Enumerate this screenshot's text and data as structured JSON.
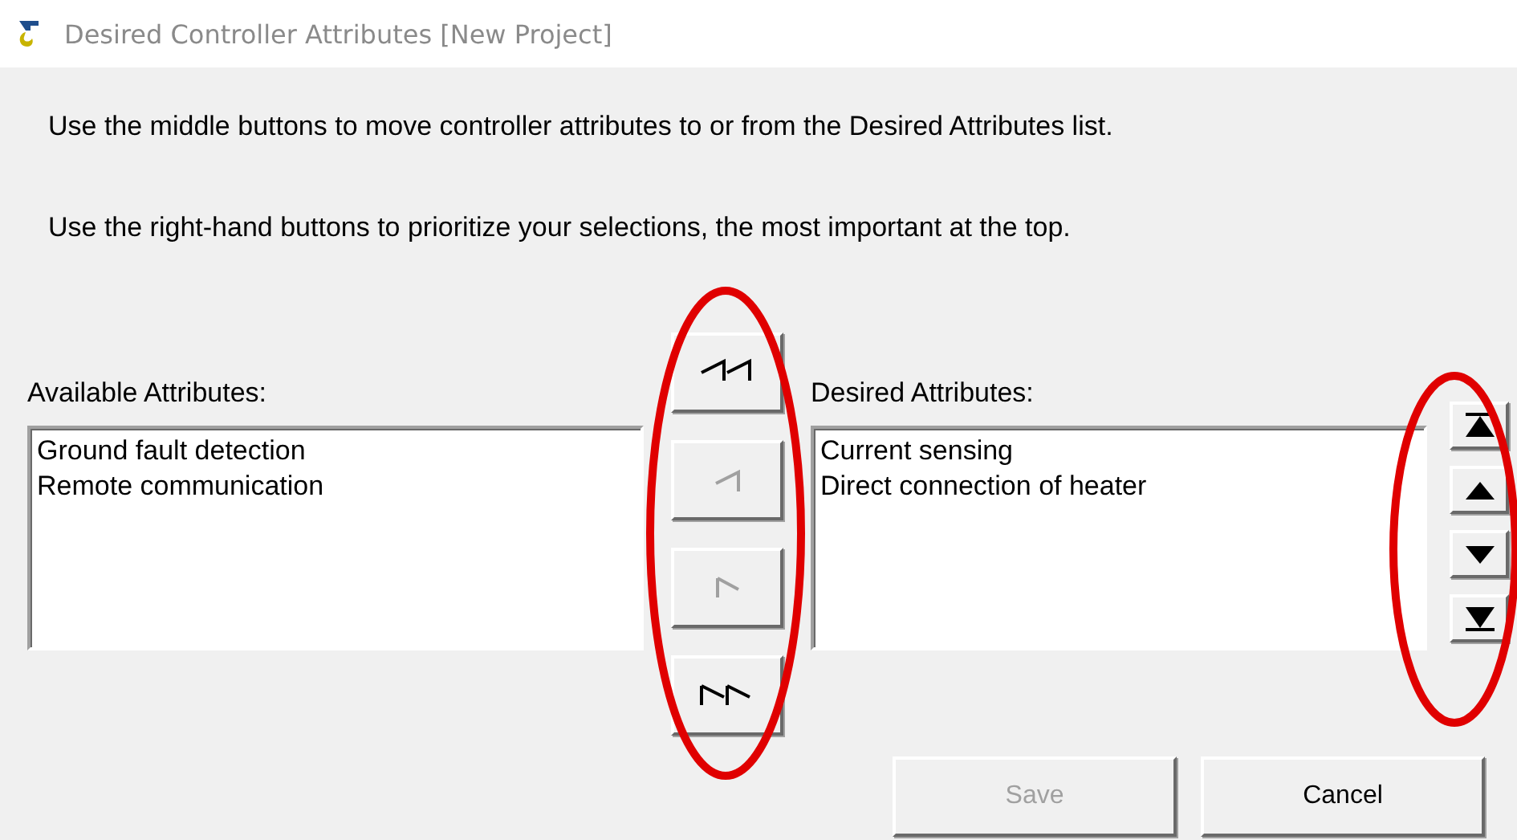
{
  "window": {
    "title": "Desired Controller Attributes [New Project]"
  },
  "instructions": [
    "Use the middle buttons to move controller attributes to or from the Desired Attributes list.",
    "Use the right-hand buttons to prioritize your selections, the most important at the top."
  ],
  "available": {
    "label": "Available Attributes:",
    "items": [
      "Ground fault detection",
      "Remote communication"
    ]
  },
  "move_buttons": [
    {
      "kind": "remove_all",
      "disabled": false
    },
    {
      "kind": "remove",
      "disabled": true
    },
    {
      "kind": "add",
      "disabled": true
    },
    {
      "kind": "add_all",
      "disabled": false
    }
  ],
  "desired": {
    "label": "Desired Attributes:",
    "items": [
      "Current sensing",
      "Direct connection of heater"
    ]
  },
  "order_buttons": [
    {
      "kind": "top"
    },
    {
      "kind": "up"
    },
    {
      "kind": "down"
    },
    {
      "kind": "bottom"
    }
  ],
  "buttons": [
    {
      "label": "Save",
      "disabled": true
    },
    {
      "label": "Cancel",
      "disabled": false
    }
  ]
}
